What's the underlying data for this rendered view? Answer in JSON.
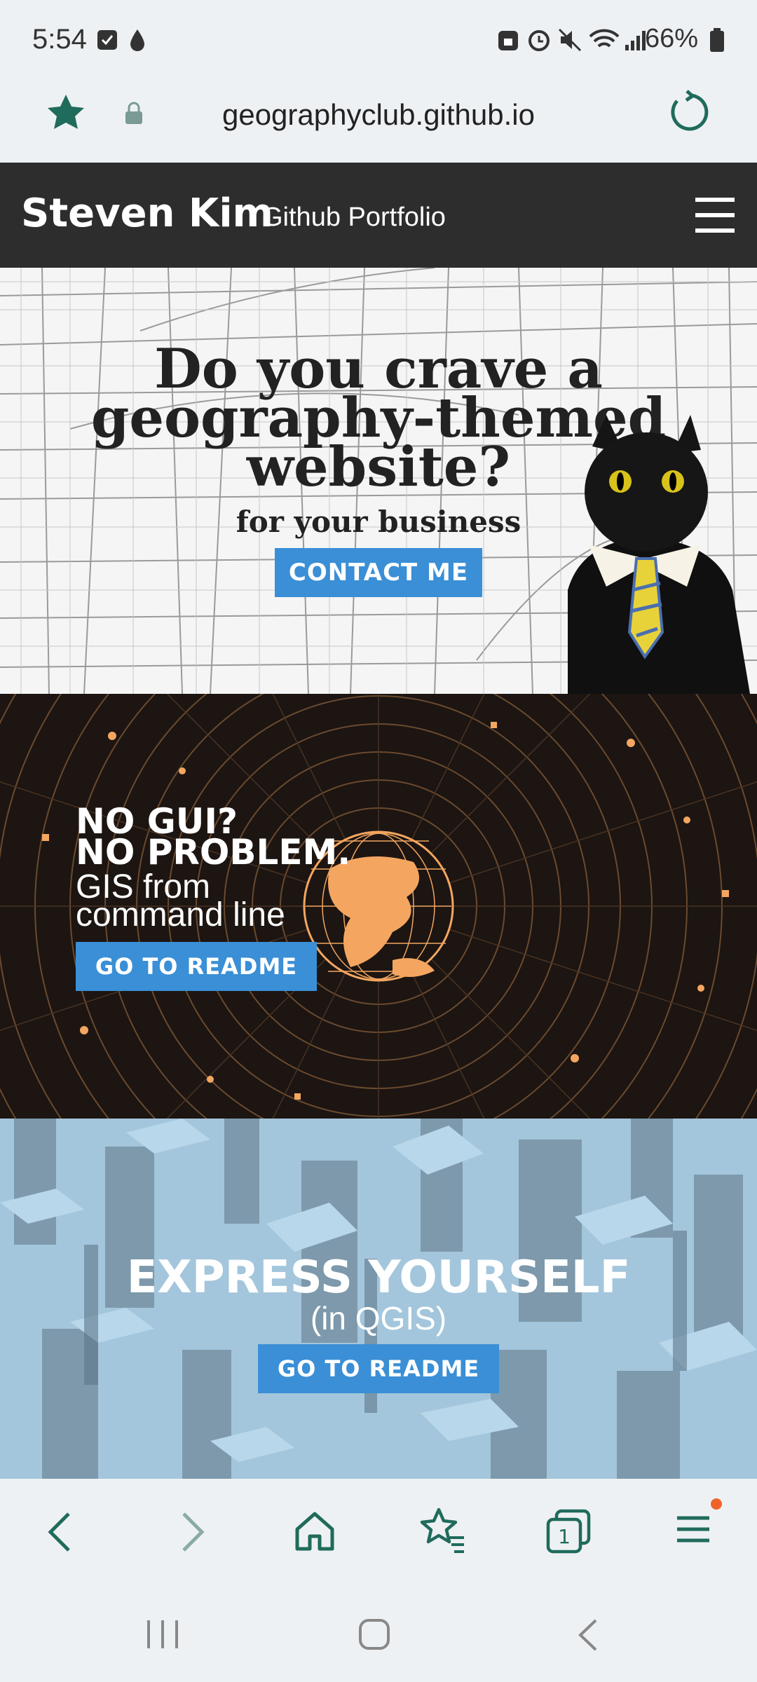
{
  "status": {
    "time": "5:54",
    "battery": "66%"
  },
  "browser": {
    "url": "geographyclub.github.io"
  },
  "header": {
    "name": "Steven Kim",
    "subtitle": "Github Portfolio"
  },
  "hero1": {
    "title_line1": "Do you crave a",
    "title_line2": "geography-themed",
    "title_line3": "website?",
    "subtitle": "for your business",
    "button": "CONTACT ME"
  },
  "hero2": {
    "line1": "NO GUI?",
    "line2": "NO PROBLEM.",
    "line3": "GIS from",
    "line4": "command line",
    "button": "GO TO README"
  },
  "hero3": {
    "title": "EXPRESS YOURSELF",
    "subtitle": "(in QGIS)",
    "button": "GO TO README"
  },
  "colors": {
    "accent": "#3a8fd6",
    "header_bg": "#2d2d2d",
    "teal": "#1f6b5c",
    "orange": "#f4a660"
  }
}
